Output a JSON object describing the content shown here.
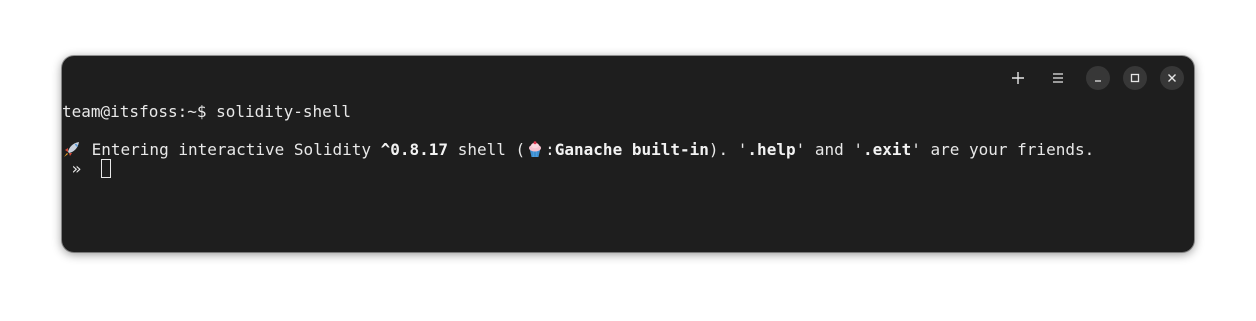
{
  "window": {
    "buttons": {
      "new_tab_icon": "plus-icon",
      "menu_icon": "hamburger-menu-icon",
      "minimize_icon": "minimize-icon",
      "maximize_icon": "maximize-icon",
      "close_icon": "close-icon"
    }
  },
  "terminal": {
    "prompt": "team@itsfoss:~$",
    "command": "solidity-shell",
    "banner": {
      "part1": " Entering interactive Solidity ",
      "version": "^0.8.17",
      "part2": " shell (",
      "part3": ":",
      "ganache": "Ganache built-in",
      "part4": "). '",
      "help": ".help",
      "part5": "' and '",
      "exit": ".exit",
      "part6": "' are your friends."
    },
    "input_prompt": " » "
  },
  "colors": {
    "background": "#1e1e1e",
    "text": "#e8e8e8"
  }
}
